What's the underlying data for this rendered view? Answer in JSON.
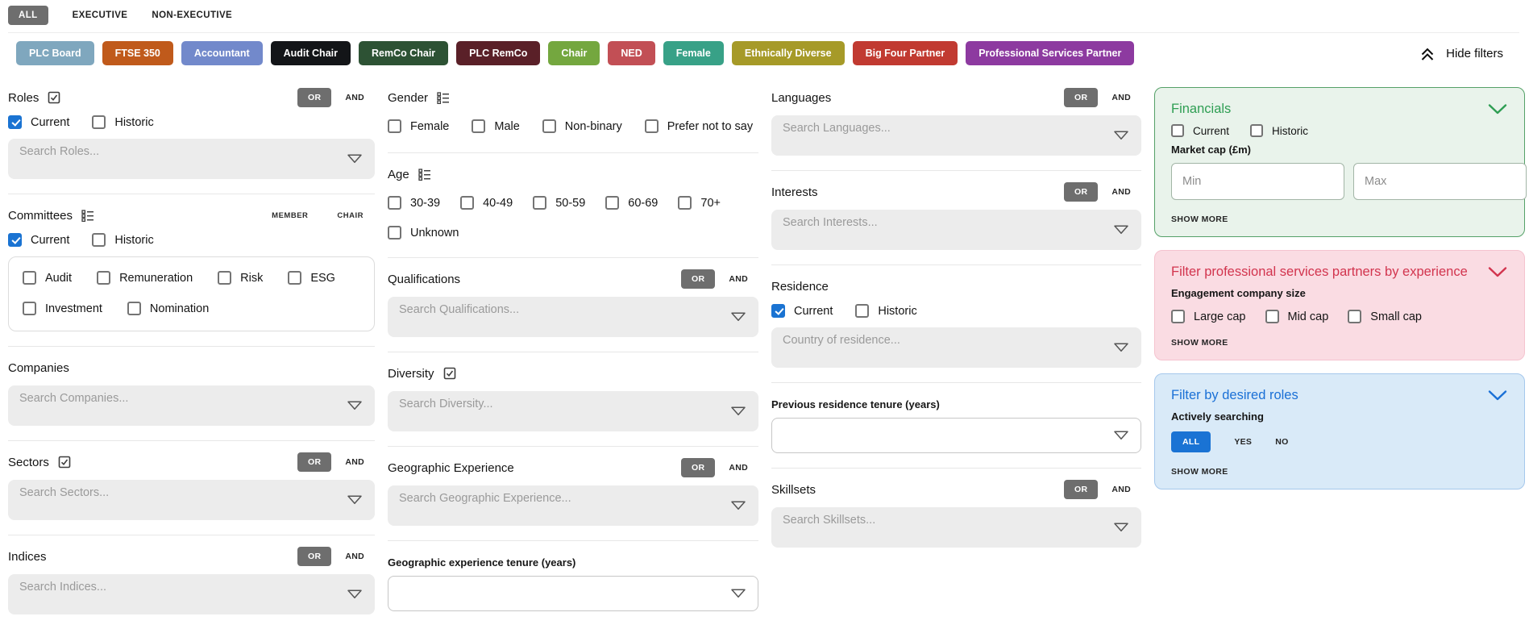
{
  "header": {
    "tabs": [
      {
        "label": "ALL",
        "active": true
      },
      {
        "label": "EXECUTIVE",
        "active": false
      },
      {
        "label": "NON-EXECUTIVE",
        "active": false
      }
    ],
    "chips": [
      {
        "label": "PLC Board",
        "color": "#7FA7BE"
      },
      {
        "label": "FTSE 350",
        "color": "#C05A1B"
      },
      {
        "label": "Accountant",
        "color": "#7289CB"
      },
      {
        "label": "Audit Chair",
        "color": "#131518"
      },
      {
        "label": "RemCo Chair",
        "color": "#2D5234"
      },
      {
        "label": "PLC RemCo",
        "color": "#5A2028"
      },
      {
        "label": "Chair",
        "color": "#74A73F"
      },
      {
        "label": "NED",
        "color": "#C24F55"
      },
      {
        "label": "Female",
        "color": "#38A187"
      },
      {
        "label": "Ethnically Diverse",
        "color": "#A69A28"
      },
      {
        "label": "Big Four Partner",
        "color": "#C13A31"
      },
      {
        "label": "Professional Services Partner",
        "color": "#8D3AA0"
      }
    ],
    "hide_filters_label": "Hide filters"
  },
  "labels": {
    "current": "Current",
    "historic": "Historic"
  },
  "logic": {
    "or": "OR",
    "and": "AND"
  },
  "col1": {
    "roles": {
      "title": "Roles",
      "placeholder": "Search Roles..."
    },
    "committees": {
      "title": "Committees",
      "member": "MEMBER",
      "chair": "CHAIR",
      "options_row1": [
        "Audit",
        "Remuneration",
        "Risk",
        "ESG"
      ],
      "options_row2": [
        "Investment",
        "Nomination"
      ]
    },
    "companies": {
      "title": "Companies",
      "placeholder": "Search Companies..."
    },
    "sectors": {
      "title": "Sectors",
      "placeholder": "Search Sectors..."
    },
    "indices": {
      "title": "Indices",
      "placeholder": "Search Indices..."
    }
  },
  "col2": {
    "gender": {
      "title": "Gender",
      "options": [
        "Female",
        "Male",
        "Non-binary",
        "Prefer not to say"
      ]
    },
    "age": {
      "title": "Age",
      "options": [
        "30-39",
        "40-49",
        "50-59",
        "60-69",
        "70+"
      ],
      "options_row2": [
        "Unknown"
      ]
    },
    "qualifications": {
      "title": "Qualifications",
      "placeholder": "Search Qualifications..."
    },
    "diversity": {
      "title": "Diversity",
      "placeholder": "Search Diversity..."
    },
    "geographic": {
      "title": "Geographic Experience",
      "placeholder": "Search Geographic Experience..."
    },
    "geo_tenure": {
      "label": "Geographic experience tenure (years)"
    }
  },
  "col3": {
    "languages": {
      "title": "Languages",
      "placeholder": "Search Languages..."
    },
    "interests": {
      "title": "Interests",
      "placeholder": "Search Interests..."
    },
    "residence": {
      "title": "Residence",
      "placeholder": "Country of residence..."
    },
    "prev_tenure": {
      "label": "Previous residence tenure (years)"
    },
    "skillsets": {
      "title": "Skillsets",
      "placeholder": "Search Skillsets..."
    }
  },
  "panels": {
    "financials": {
      "title": "Financials",
      "market_cap_label": "Market cap (£m)",
      "min_placeholder": "Min",
      "max_placeholder": "Max",
      "show_more": "SHOW MORE",
      "accent": "#2E9E53",
      "bg": "#E9F3EB",
      "border": "#55A168"
    },
    "partners": {
      "title": "Filter professional services partners by experience",
      "subtitle": "Engagement company size",
      "options": [
        "Large cap",
        "Mid cap",
        "Small cap"
      ],
      "show_more": "SHOW MORE",
      "accent": "#D2344E",
      "bg": "#FADCE3",
      "border": "#F5C3CF"
    },
    "desired": {
      "title": "Filter by desired roles",
      "subtitle": "Actively searching",
      "segments": [
        {
          "label": "ALL",
          "active": true
        },
        {
          "label": "YES",
          "active": false
        },
        {
          "label": "NO",
          "active": false
        }
      ],
      "show_more": "SHOW MORE",
      "accent": "#1A70D6",
      "bg": "#D9EAF8",
      "border": "#A5C8EC"
    }
  }
}
